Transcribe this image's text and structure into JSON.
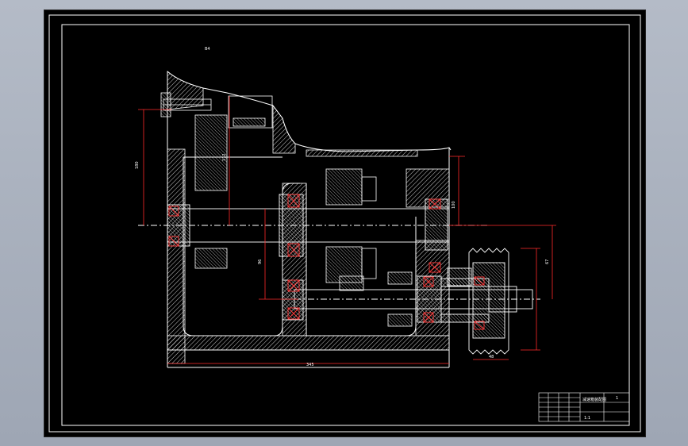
{
  "drawing": {
    "view_label": "B4",
    "title_block": {
      "sheet_no": "1",
      "title": "减速箱装配图",
      "scale": "1:1"
    },
    "colors": {
      "background": "#000000",
      "outline": "#ffffff",
      "dimension": "#ff2a2a",
      "hatch": "#ffffff",
      "bearing": "#ff3333"
    }
  }
}
